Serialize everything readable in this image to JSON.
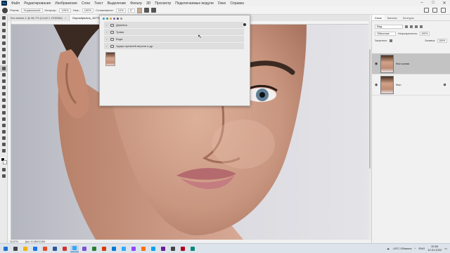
{
  "app": {
    "logo": "Ps"
  },
  "menu": [
    "Файл",
    "Редактирование",
    "Изображение",
    "Слои",
    "Текст",
    "Выделение",
    "Фильтр",
    "3D",
    "Просмотр",
    "Подключаемые модули",
    "Окно",
    "Справка"
  ],
  "options_bar": {
    "mode_label": "Режим:",
    "mode_value": "Нормальный",
    "opacity_label": "Непрозр.:",
    "opacity_value": "100%",
    "flow_label": "Наж.:",
    "flow_value": "100%",
    "smoothing_label": "Сглаживание:",
    "smoothing_value": "10%",
    "angle_value": "0°",
    "swatch_color": "#c5a98f"
  },
  "document_tabs": [
    {
      "label": "Без имени-1 @ 66,7% (Слой 1, RGB/8#)",
      "active": false
    },
    {
      "label": "Depositphotos_167766",
      "active": true
    }
  ],
  "status_bar": {
    "zoom": "16,67%",
    "doc": "Док: 10,8М/10,8М"
  },
  "brush_popup": {
    "groups": [
      "Деревья",
      "Трава",
      "Вода",
      "Удары прежней версии и др."
    ],
    "top_colors": [
      "#4a90c8",
      "#3a9b6a",
      "#d0a33a",
      "#8a5ab0",
      "#555555",
      "#999999"
    ]
  },
  "panels": {
    "tabs": [
      "Слои",
      "Каналы",
      "Контуры"
    ],
    "active_tab": "Слои",
    "search_label": "Вид",
    "blend_mode": "Обычные",
    "opacity_label": "Непрозрачность:",
    "opacity_value": "100%",
    "fill_label": "Заливка:",
    "fill_value": "100%",
    "lock_label": "Закрепить:",
    "layers": [
      {
        "name": "Фон копия",
        "selected": true
      },
      {
        "name": "Фон",
        "selected": false
      }
    ]
  },
  "taskbar": {
    "weather": "-15°C Облачно",
    "lang": "ENG",
    "time": "20:50",
    "date": "12.01.2022",
    "app_colors": [
      "#1f6fd1",
      "#444444",
      "#f2b400",
      "#1a73e8",
      "#e34c26",
      "#2b579a",
      "#c33",
      "#31a8ff",
      "#7b4fd6",
      "#2e7d32",
      "#d83b01",
      "#0078d4",
      "#31a8ff",
      "#9146ff",
      "#ff6f00",
      "#00a4ef",
      "#6a1b9a",
      "#444444",
      "#2a2a2a",
      "#b00020",
      "#00897b"
    ]
  }
}
